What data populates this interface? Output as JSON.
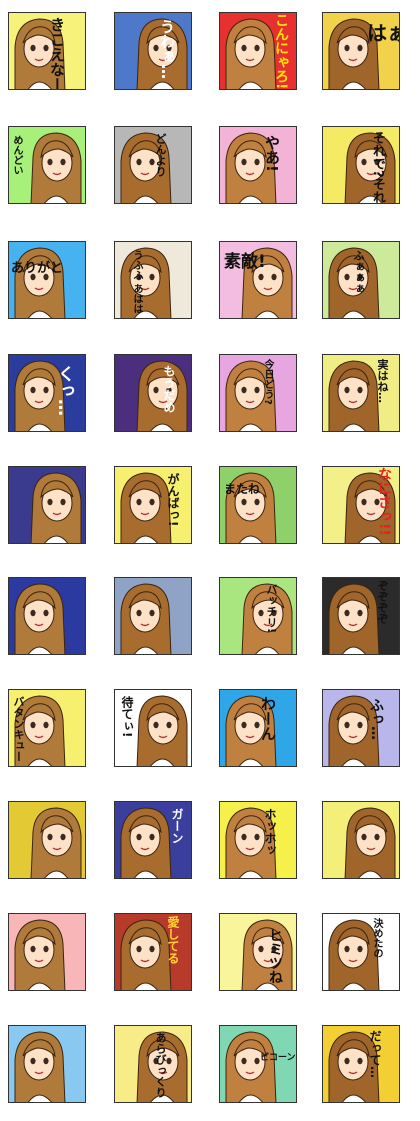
{
  "title": "",
  "stickers": [
    {
      "bg": "#f7f27a",
      "text": "きこえなーい",
      "color": "#111"
    },
    {
      "bg": "#4e78c9",
      "text": "うわぁ…",
      "color": "#fff"
    },
    {
      "bg": "#e83030",
      "text": "こんにゃろ!",
      "color": "#ffe400"
    },
    {
      "bg": "#f1d24a",
      "text": "はぁ?",
      "color": "#111"
    },
    {
      "bg": "#a7f07a",
      "text": "めんどい",
      "color": "#111"
    },
    {
      "bg": "#b7b7b7",
      "text": "どんより",
      "color": "#111"
    },
    {
      "bg": "#f3b3d6",
      "text": "やあ!",
      "color": "#111"
    },
    {
      "bg": "#f5ea63",
      "text": "それで?それで?",
      "color": "#111"
    },
    {
      "bg": "#46b3f0",
      "text": "ありがと",
      "color": "#111"
    },
    {
      "bg": "#efe9dc",
      "text": "うふふ あはは",
      "color": "#111"
    },
    {
      "bg": "#f2bde0",
      "text": "素敵!",
      "color": "#111"
    },
    {
      "bg": "#cde99a",
      "text": "ふぁぁぁ",
      "color": "#111"
    },
    {
      "bg": "#2a3c9e",
      "text": "くっ…",
      "color": "#fff"
    },
    {
      "bg": "#4b2e7e",
      "text": "もうだめ",
      "color": "#fff"
    },
    {
      "bg": "#e7a6e0",
      "text": "今日どう?",
      "color": "#111"
    },
    {
      "bg": "#f1ed85",
      "text": "実はね…",
      "color": "#111"
    },
    {
      "bg": "#3a3a8f",
      "text": "",
      "color": "#fff"
    },
    {
      "bg": "#f7f06e",
      "text": "がんばっ!",
      "color": "#111"
    },
    {
      "bg": "#8ed16a",
      "text": "またね",
      "color": "#111"
    },
    {
      "bg": "#f3f08a",
      "text": "なにさっ!!",
      "color": "#e72020"
    },
    {
      "bg": "#2b3aa0",
      "text": "",
      "color": "#fff"
    },
    {
      "bg": "#8fa3c6",
      "text": "",
      "color": "#fff"
    },
    {
      "bg": "#a9e67f",
      "text": "バッチリ!",
      "color": "#111"
    },
    {
      "bg": "#2b2b2b",
      "text": "ぞぞぞぞ",
      "color": "#111"
    },
    {
      "bg": "#f7f06e",
      "text": "バタンキュー",
      "color": "#111"
    },
    {
      "bg": "#ffffff",
      "text": "待てぃ!",
      "color": "#111"
    },
    {
      "bg": "#2ea6e8",
      "text": "わーん",
      "color": "#111"
    },
    {
      "bg": "#b9b6ec",
      "text": "ふっ…",
      "color": "#111"
    },
    {
      "bg": "#e3c933",
      "text": "",
      "color": "#111"
    },
    {
      "bg": "#3a3e9c",
      "text": "ガーン",
      "color": "#fff"
    },
    {
      "bg": "#f5f04a",
      "text": "ホッホッ",
      "color": "#111"
    },
    {
      "bg": "#f4ef79",
      "text": "",
      "color": "#111"
    },
    {
      "bg": "#f9b6b9",
      "text": "",
      "color": "#111"
    },
    {
      "bg": "#b83a2a",
      "text": "愛してる",
      "color": "#ffd233"
    },
    {
      "bg": "#f8f59a",
      "text": "ヒミツね",
      "color": "#111"
    },
    {
      "bg": "#ffffff",
      "text": "決めたの",
      "color": "#111"
    },
    {
      "bg": "#89c8f0",
      "text": "",
      "color": "#111"
    },
    {
      "bg": "#f7ec87",
      "text": "あらびっくり",
      "color": "#111"
    },
    {
      "bg": "#7fd8b3",
      "text": "ピコーン",
      "color": "#111"
    },
    {
      "bg": "#f3cf33",
      "text": "だって…",
      "color": "#111"
    }
  ]
}
